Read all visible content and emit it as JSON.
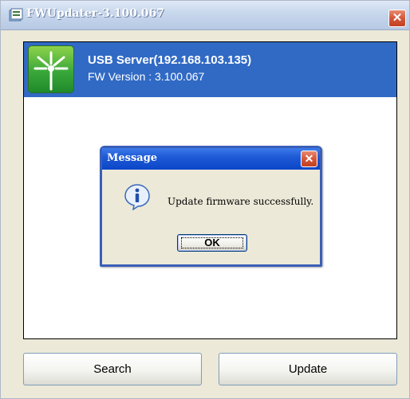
{
  "window": {
    "title": "FWUpdater-3.100.067",
    "close_glyph": "✕",
    "title_icon": "app-icon"
  },
  "device": {
    "name": "USB Server(192.168.103.135)",
    "fw_version": "FW Version : 3.100.067",
    "icon": "usb-server-icon",
    "selected": true,
    "selection_color": "#316ac5"
  },
  "dialog": {
    "title": "Message",
    "close_glyph": "✕",
    "icon": "info-icon",
    "message": "Update firmware successfully.",
    "ok_label": "OK"
  },
  "buttons": {
    "search_label": "Search",
    "update_label": "Update"
  },
  "colors": {
    "dialog_title_blue": "#1f5ad6",
    "close_red": "#d4573a",
    "window_bg": "#ece9d8"
  }
}
